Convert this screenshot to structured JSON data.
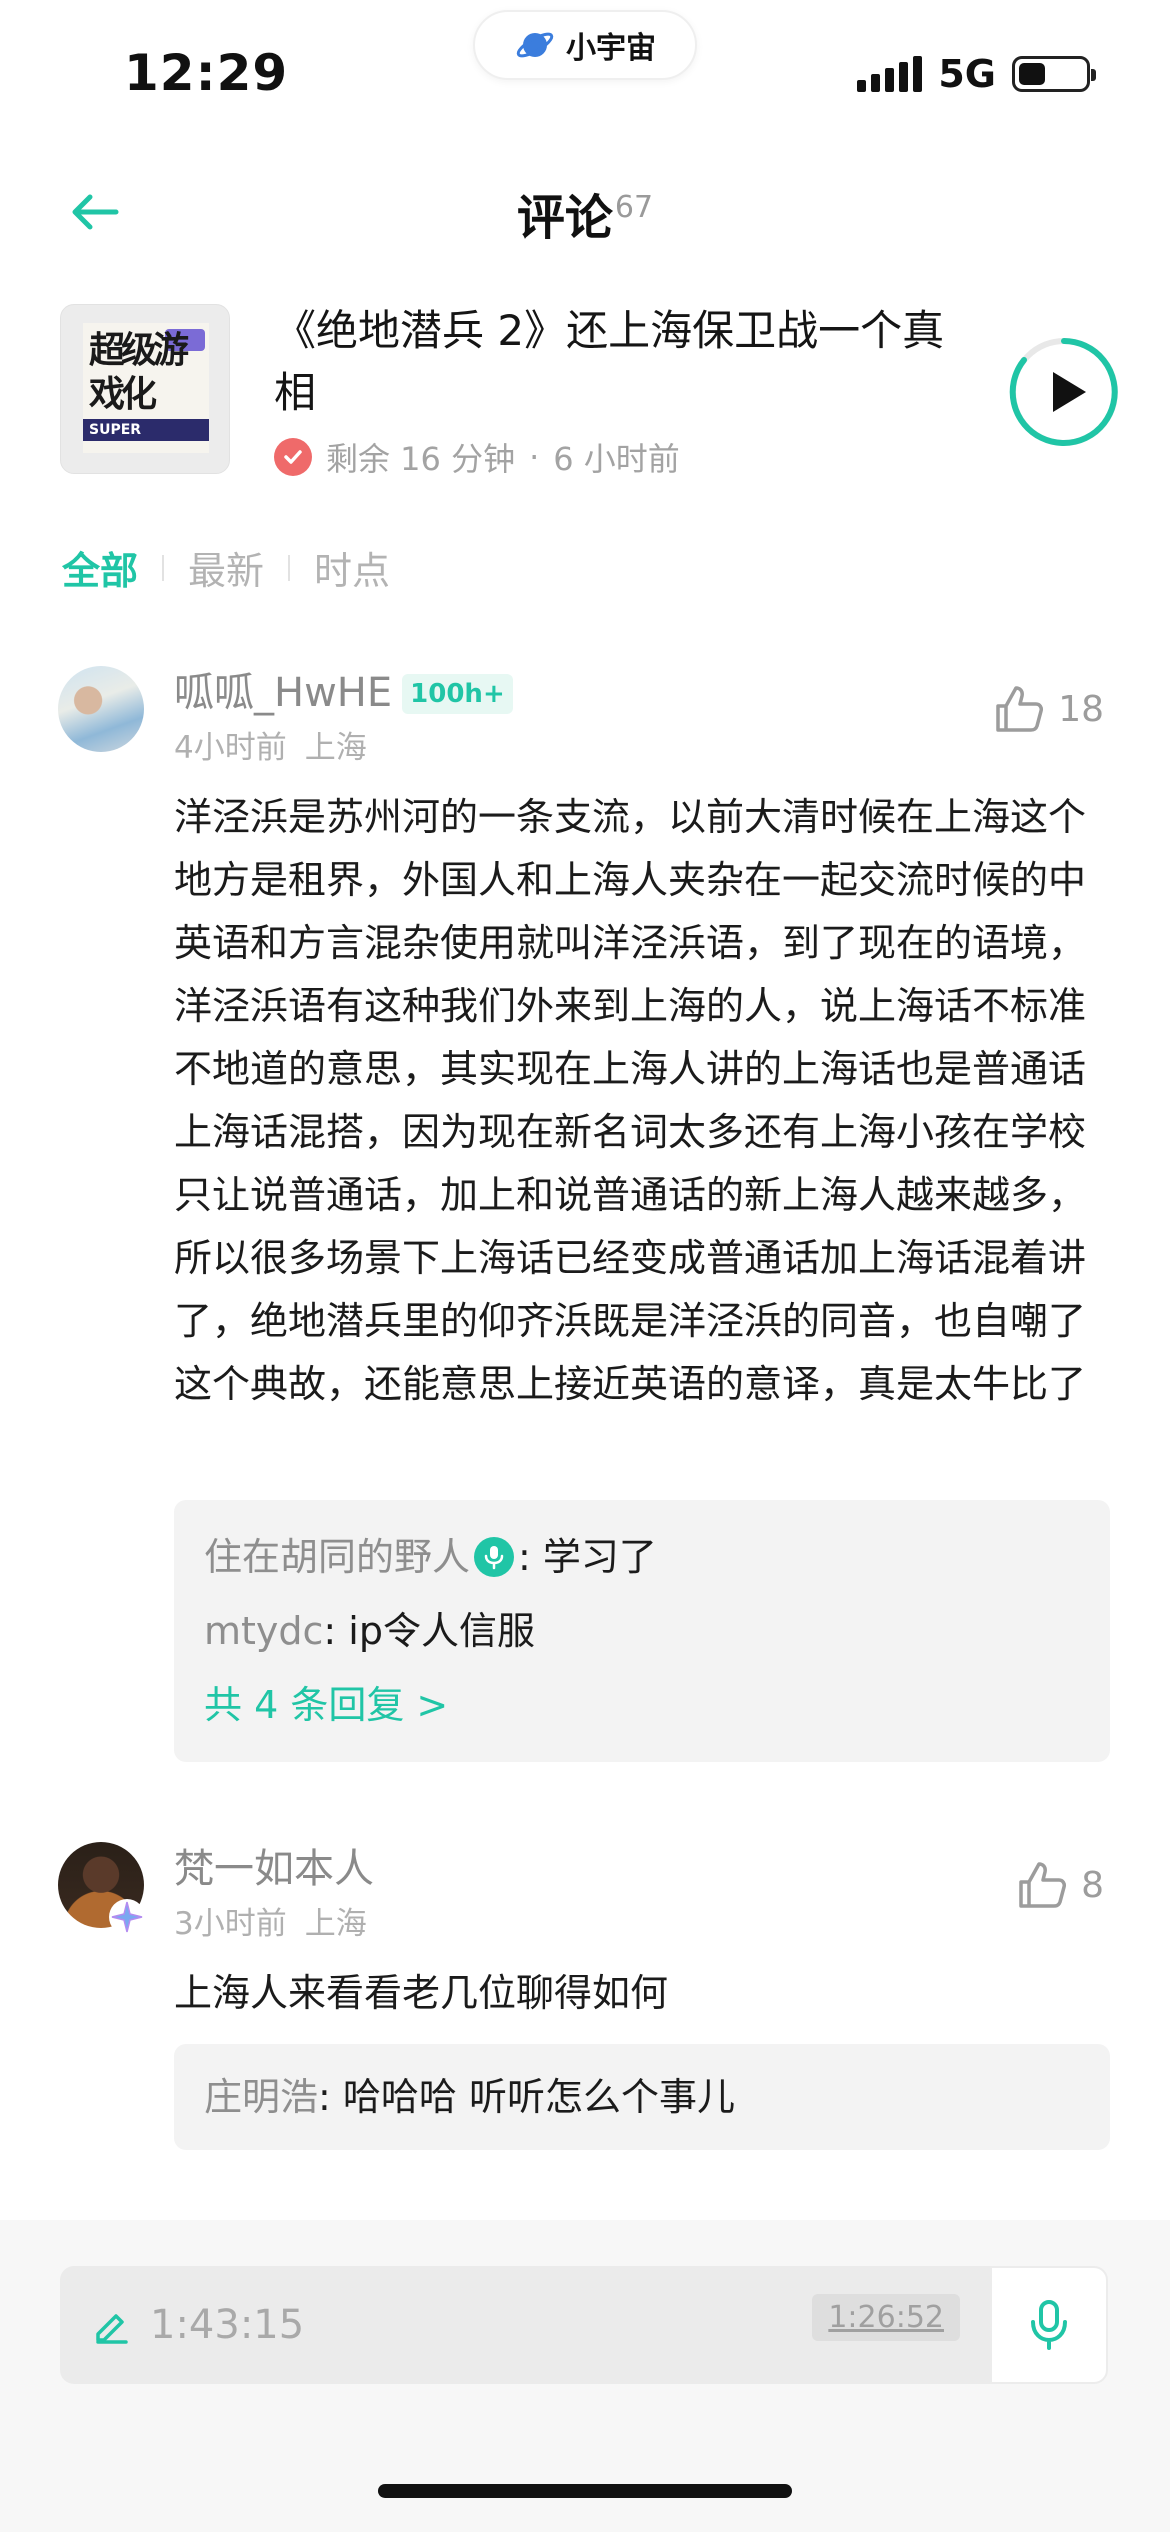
{
  "status_bar": {
    "time": "12:29",
    "app_name": "小宇宙",
    "network": "5G",
    "battery_level": 0.4
  },
  "header": {
    "title": "评论",
    "count": "67"
  },
  "episode": {
    "title": "《绝地潜兵 2》还上海保卫战一个真相",
    "remaining": "剩余 16 分钟",
    "separator": "·",
    "published": "6 小时前",
    "cover_text": "超级游戏化",
    "cover_caption": "SUPER"
  },
  "tabs": [
    {
      "label": "全部",
      "active": true
    },
    {
      "label": "最新",
      "active": false
    },
    {
      "label": "时点",
      "active": false
    }
  ],
  "comments": [
    {
      "author": "呱呱_HwHE",
      "level": "100h+",
      "time": "4小时前",
      "location": "上海",
      "likes": "18",
      "body": "洋泾浜是苏州河的一条支流，以前大清时候在上海这个地方是租界，外国人和上海人夹杂在一起交流时候的中英语和方言混杂使用就叫洋泾浜语，到了现在的语境，洋泾浜语有这种我们外来到上海的人，说上海话不标准不地道的意思，其实现在上海人讲的上海话也是普通话上海话混搭，因为现在新名词太多还有上海小孩在学校只让说普通话，加上和说普通话的新上海人越来越多，所以很多场景下上海话已经变成普通话加上海话混着讲了，绝地潜兵里的仰齐浜既是洋泾浜的同音，也自嘲了这个典故，还能意思上接近英语的意译，真是太牛比了",
      "replies": [
        {
          "author": "住在胡同的野人",
          "text": ": 学习了"
        },
        {
          "author": "mtydc",
          "text": ": ip令人信服"
        }
      ],
      "more_replies": "共 4 条回复 >"
    },
    {
      "author": "梵一如本人",
      "time": "3小时前",
      "location": "上海",
      "likes": "8",
      "body": "上海人来看看老几位聊得如何",
      "replies": [
        {
          "author": "庄明浩",
          "text": ": 哈哈哈 听听怎么个事儿"
        }
      ]
    }
  ],
  "composer": {
    "timestamp": "1:43:15",
    "current_position": "1:26:52"
  },
  "colors": {
    "accent": "#20c5a6",
    "muted_text": "#a3a3a3",
    "reply_bg": "#f3f3f3"
  }
}
